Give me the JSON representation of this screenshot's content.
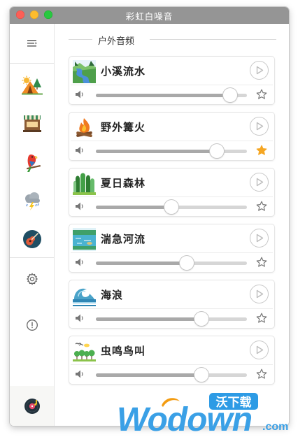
{
  "window": {
    "title": "彩虹白噪音"
  },
  "sidebar": {
    "items": [
      {
        "icon": "menu-icon"
      },
      {
        "icon": "camping-icon"
      },
      {
        "icon": "cafe-icon"
      },
      {
        "icon": "parrot-icon"
      },
      {
        "icon": "thunderstorm-icon"
      },
      {
        "icon": "guitar-icon"
      },
      {
        "icon": "gear-icon"
      },
      {
        "icon": "info-icon"
      },
      {
        "icon": "vinyl-record-icon"
      }
    ]
  },
  "section": {
    "title": "户外音频"
  },
  "sounds": [
    {
      "name": "小溪流水",
      "icon": "stream-icon",
      "volume": 0.89,
      "favorite": false
    },
    {
      "name": "野外篝火",
      "icon": "campfire-icon",
      "volume": 0.8,
      "favorite": true
    },
    {
      "name": "夏日森林",
      "icon": "forest-icon",
      "volume": 0.5,
      "favorite": false
    },
    {
      "name": "湍急河流",
      "icon": "river-icon",
      "volume": 0.6,
      "favorite": false
    },
    {
      "name": "海浪",
      "icon": "wave-icon",
      "volume": 0.7,
      "favorite": false
    },
    {
      "name": "虫鸣鸟叫",
      "icon": "birds-trees-icon",
      "volume": 0.7,
      "favorite": false
    }
  ],
  "colors": {
    "favorite_star": "#f5a623",
    "slider_fill": "#a9a9a9",
    "slider_track": "#d6d6d6"
  },
  "watermark": {
    "brand": "Wodown",
    "badge": "沃下载",
    "suffix": ".com"
  }
}
